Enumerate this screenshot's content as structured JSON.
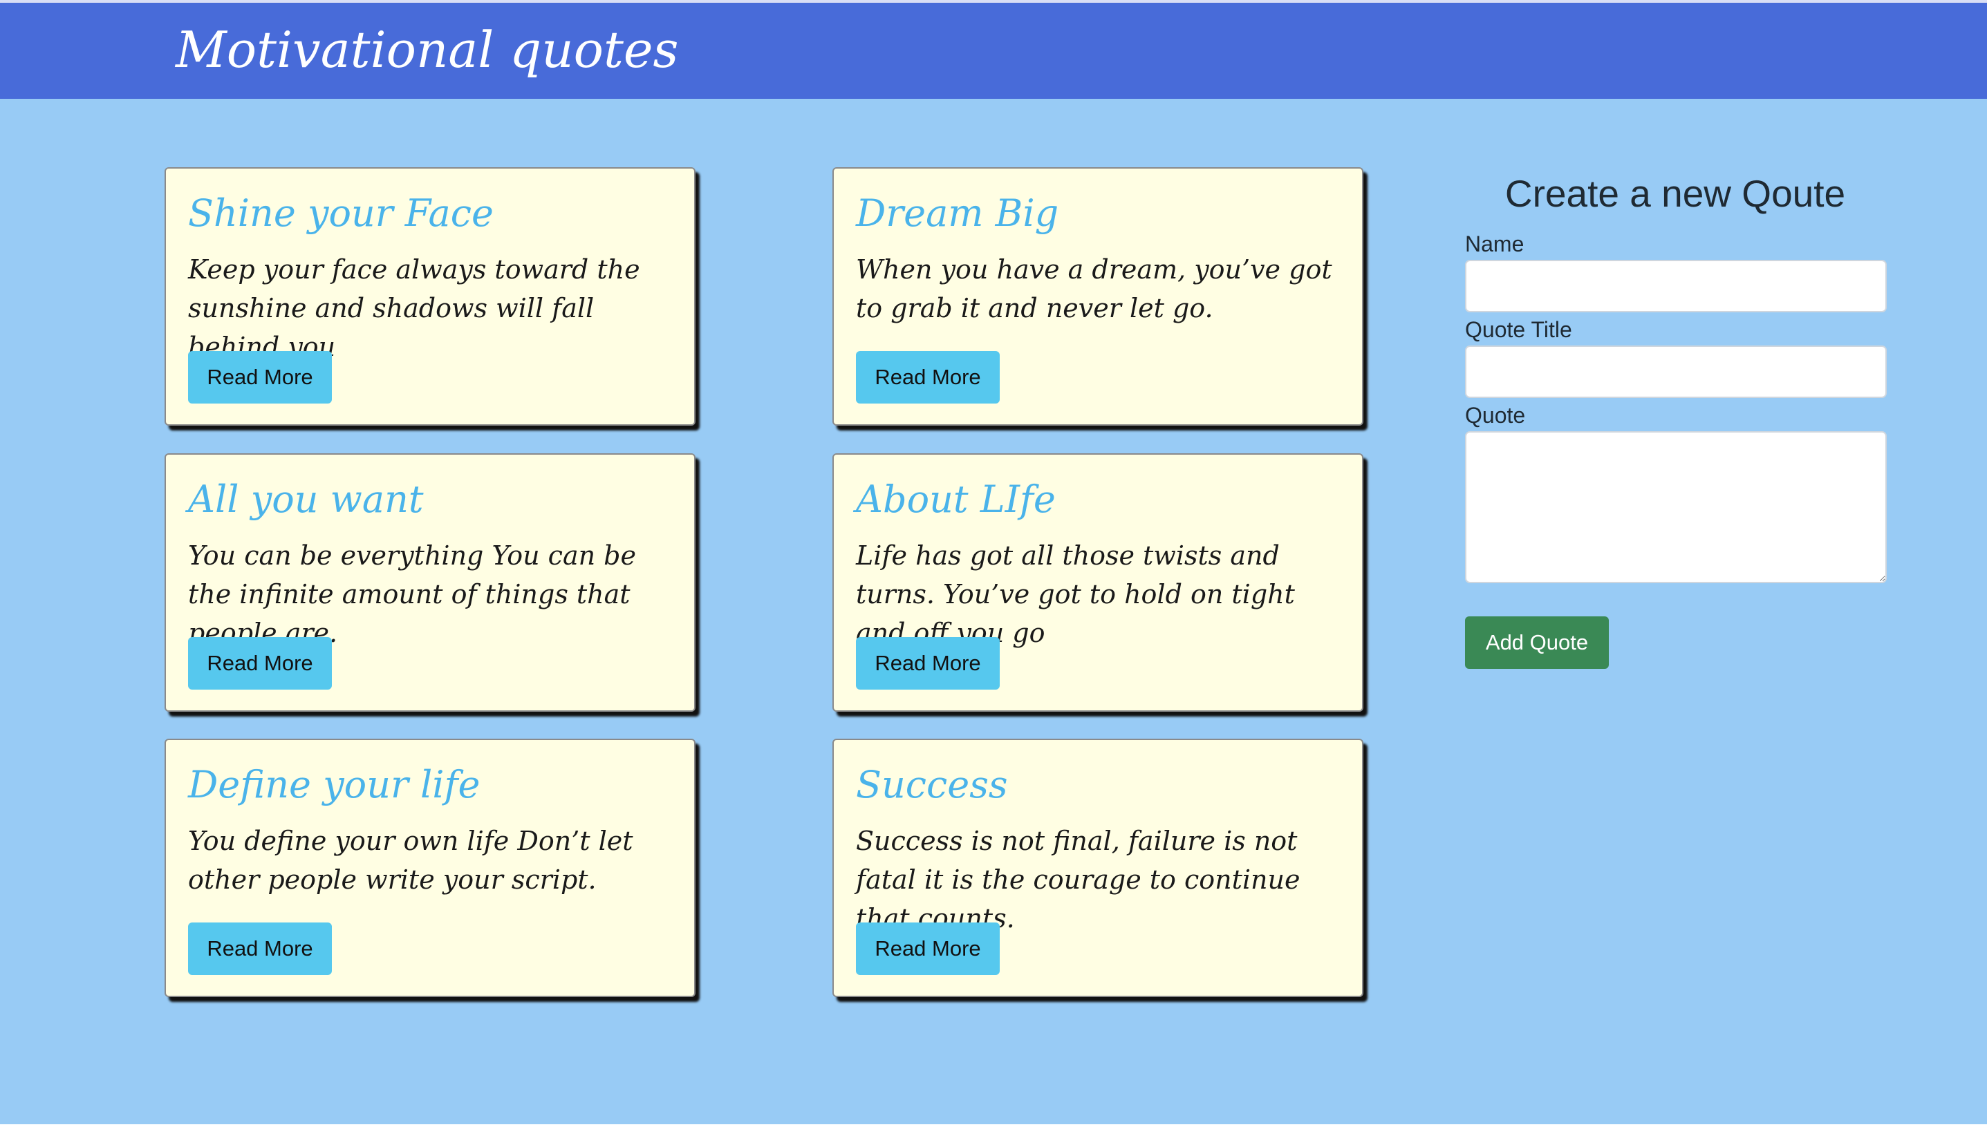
{
  "header": {
    "title": "Motivational quotes"
  },
  "quotes": [
    {
      "title": "Shine your Face",
      "text": "Keep your face always toward the sunshine and shadows will fall behind you",
      "button_label": "Read More"
    },
    {
      "title": "Dream Big",
      "text": "When you have a dream, you’ve got to grab it and never let go.",
      "button_label": "Read More"
    },
    {
      "title": "All you want",
      "text": "You can be everything You can be the infinite amount of things that people are.",
      "button_label": "Read More"
    },
    {
      "title": "About LIfe",
      "text": "Life has got all those twists and turns. You’ve got to hold on tight and off you go",
      "button_label": "Read More"
    },
    {
      "title": "Define your life",
      "text": "You define your own life Don’t let other people write your script.",
      "button_label": "Read More"
    },
    {
      "title": "Success",
      "text": "Success is not final, failure is not fatal it is the courage to continue that counts.",
      "button_label": "Read More"
    }
  ],
  "form": {
    "heading": "Create a new Qoute",
    "name_label": "Name",
    "name_value": "",
    "title_label": "Quote Title",
    "title_value": "",
    "quote_label": "Quote",
    "quote_value": "",
    "submit_label": "Add Quote"
  },
  "colors": {
    "header_background": "#486bd9",
    "page_background": "#98cbf5",
    "card_background": "#fffee3",
    "card_title": "#4ab3ea",
    "read_more_button": "#56c8ee",
    "add_quote_button": "#3a8955"
  }
}
